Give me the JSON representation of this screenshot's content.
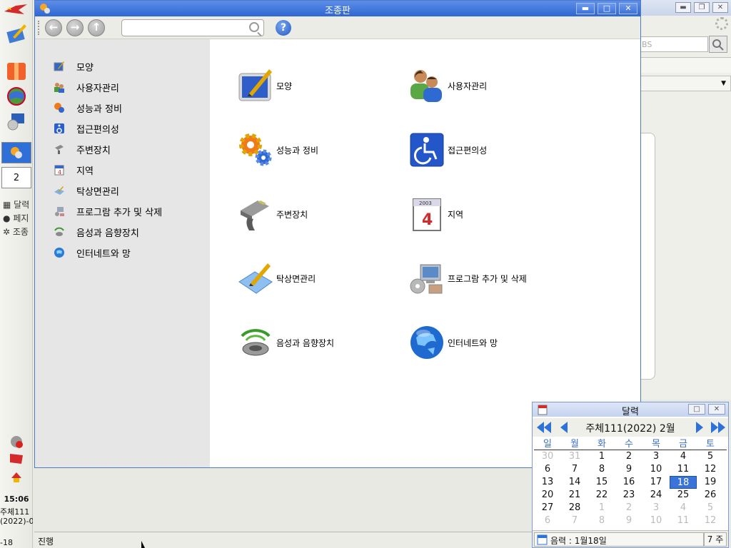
{
  "taskbar": {
    "task_number": "2",
    "tasks": [
      "달력",
      "페지",
      "조종"
    ],
    "clock_time": "15:06",
    "clock_year": "주체111",
    "clock_date": "(2022)-0",
    "clock_day": "-18"
  },
  "background_window": {
    "search_placeholder": "BS"
  },
  "window": {
    "title": "조종판",
    "controls": {
      "minimize": "▬",
      "maximize": "□",
      "close": "✕"
    },
    "toolbar": {
      "search_placeholder": "",
      "back": "←",
      "forward": "→",
      "up": "↑",
      "help": "?"
    },
    "sidebar": [
      {
        "label": "모양",
        "icon": "appearance-icon"
      },
      {
        "label": "사용자관리",
        "icon": "users-icon"
      },
      {
        "label": "성능과 정비",
        "icon": "performance-icon"
      },
      {
        "label": "접근편의성",
        "icon": "accessibility-icon"
      },
      {
        "label": "주변장치",
        "icon": "peripherals-icon"
      },
      {
        "label": "지역",
        "icon": "region-icon"
      },
      {
        "label": "탁상면관리",
        "icon": "desktop-icon"
      },
      {
        "label": "프로그람 추가 및 삭제",
        "icon": "programs-icon"
      },
      {
        "label": "음성과 음향장치",
        "icon": "sound-icon"
      },
      {
        "label": "인터네트와 망",
        "icon": "internet-icon"
      }
    ],
    "grid": [
      {
        "label": "모양"
      },
      {
        "label": "사용자관리"
      },
      {
        "label": "성능과 정비"
      },
      {
        "label": "접근편의성"
      },
      {
        "label": "주변장치"
      },
      {
        "label": "지역"
      },
      {
        "label": "탁상면관리"
      },
      {
        "label": "프로그람 추가 및 삭제"
      },
      {
        "label": "음성과 음향장치"
      },
      {
        "label": "인터네트와 망"
      }
    ]
  },
  "statusbar": {
    "text": "진행"
  },
  "calendar": {
    "title": "달력",
    "month_label": "주체111(2022)  2월",
    "weekdays": [
      "일",
      "월",
      "화",
      "수",
      "목",
      "금",
      "토"
    ],
    "weeks": [
      [
        "30",
        "31",
        "1",
        "2",
        "3",
        "4",
        "5"
      ],
      [
        "6",
        "7",
        "8",
        "9",
        "10",
        "11",
        "12"
      ],
      [
        "13",
        "14",
        "15",
        "16",
        "17",
        "18",
        "19"
      ],
      [
        "20",
        "21",
        "22",
        "23",
        "24",
        "25",
        "26"
      ],
      [
        "27",
        "28",
        "1",
        "2",
        "3",
        "4",
        "5"
      ],
      [
        "6",
        "7",
        "8",
        "9",
        "10",
        "11",
        "12"
      ]
    ],
    "selected_day": "18",
    "lunar": "음력 : 1월18일",
    "week_number": "7 주"
  },
  "colors": {
    "titlebar": "#2f66d2",
    "selected": "#3a74d8",
    "weekday_header": "#3a6fc7"
  }
}
